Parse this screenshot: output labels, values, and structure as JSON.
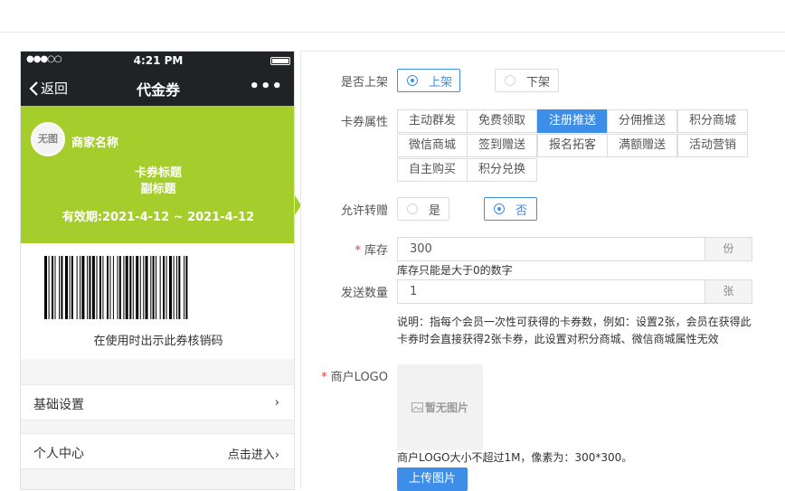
{
  "colors": {
    "accent": "#3d8ee8",
    "card_bg": "#a5cd2b",
    "navbar_bg": "#1f2326",
    "required": "#e4393c"
  },
  "phone": {
    "status_time": "4:21 PM",
    "signal": "●●●○○",
    "back_label": "返回",
    "nav_title": "代金券",
    "more_label": "•••",
    "card": {
      "logo_text": "无图",
      "merchant_name": "商家名称",
      "title": "卡券标题",
      "subtitle": "副标题",
      "validity": "有效期:2021-4-12 ~ 2021-4-12"
    },
    "barcode_caption": "在使用时出示此券核销码",
    "menu": [
      {
        "label": "基础设置",
        "right": "›"
      },
      {
        "label": "个人中心",
        "right": "点击进入›"
      }
    ]
  },
  "form": {
    "listing": {
      "label": "是否上架",
      "options": [
        "上架",
        "下架"
      ],
      "selected": "上架"
    },
    "attributes": {
      "label": "卡券属性",
      "items": [
        "主动群发",
        "免费领取",
        "注册推送",
        "分佣推送",
        "积分商城",
        "微信商城",
        "签到赠送",
        "报名拓客",
        "满额赠送",
        "活动营销",
        "自主购买",
        "积分兑换"
      ],
      "selected": "注册推送"
    },
    "transfer": {
      "label": "允许转赠",
      "options": [
        "是",
        "否"
      ],
      "selected": "否"
    },
    "stock": {
      "label": "库存",
      "value": "300",
      "unit": "份",
      "hint": "库存只能是大于0的数字"
    },
    "send_count": {
      "label": "发送数量",
      "value": "1",
      "unit": "张",
      "note_line1": "说明：指每个会员一次性可获得的卡券数，例如：设置2张，会员在获得此",
      "note_line2": "卡券时会直接获得2张卡券，此设置对积分商城、微信商城属性无效"
    },
    "merchant_logo": {
      "label": "商户LOGO",
      "placeholder": "暂无图片",
      "hint": "商户LOGO大小不超过1M，像素为：300*300。",
      "upload_label": "上传图片"
    }
  }
}
